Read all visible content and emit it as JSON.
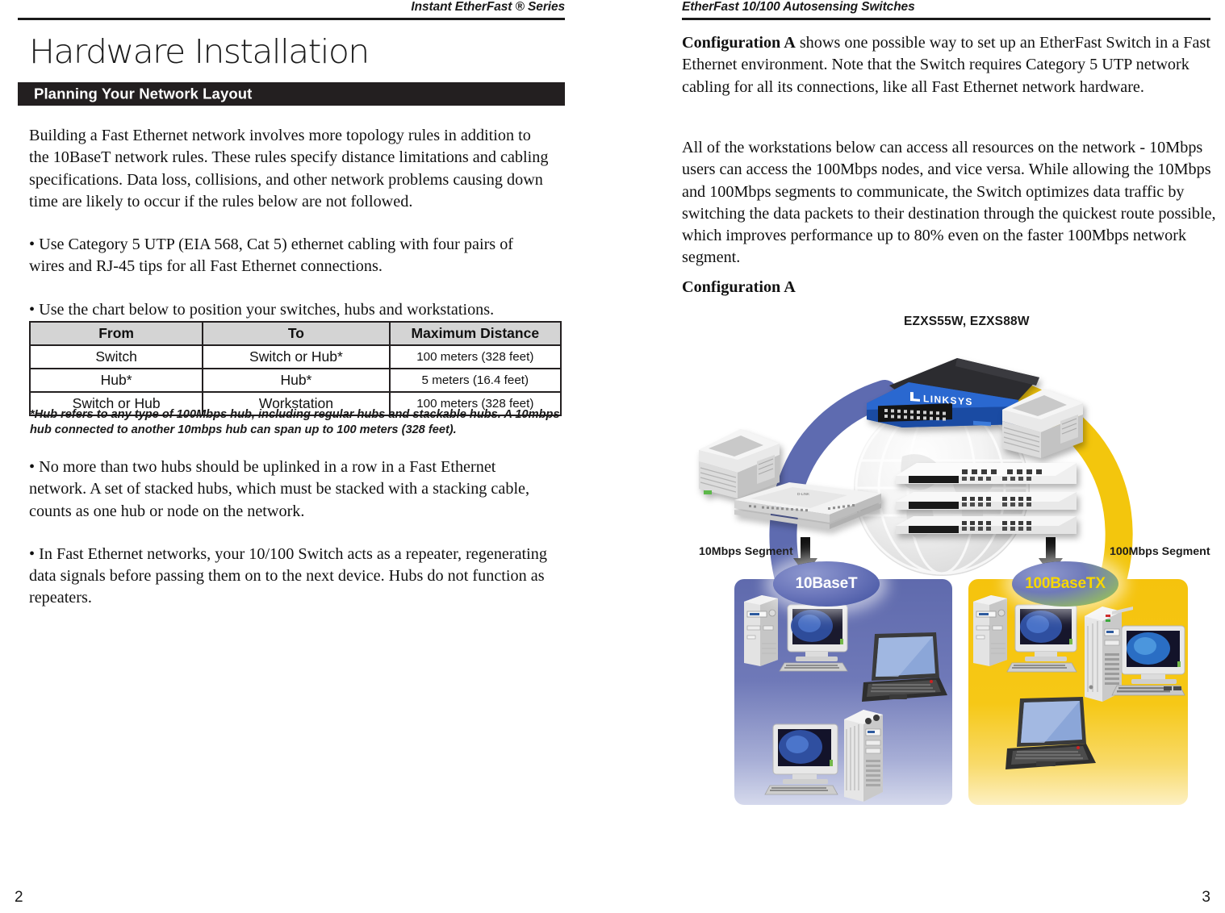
{
  "meta": {
    "left_page_number": "2",
    "right_page_number": "3"
  },
  "left_page": {
    "running_head": "Instant EtherFast ® Series",
    "title": "Hardware Installation",
    "section_bar_label": "Planning Your Network Layout",
    "intro_paragraph": "Building a Fast Ethernet network involves more topology rules in addition to the 10BaseT network rules.  These rules specify distance limitations and cabling specifications.  Data loss, collisions, and other network problems causing down time are likely to occur if the rules below are not followed.",
    "bullet_1": "• Use Category 5 UTP (EIA 568, Cat 5) ethernet cabling with four pairs of wires and RJ-45 tips for all Fast Ethernet connections.",
    "bullet_2": "• Use the chart below to position your switches, hubs and workstations.",
    "bullet_3": "• No more than two hubs should be uplinked in a row in a Fast Ethernet network.  A set of stacked hubs, which must be stacked with a stacking cable, counts as one hub or node on the network.",
    "bullet_4": "• In Fast Ethernet networks, your 10/100 Switch acts as a repeater, regenerating data signals before passing them on to the next device.  Hubs do not function as repeaters.",
    "table": {
      "headers": [
        "From",
        "To",
        "Maximum Distance"
      ],
      "rows": [
        [
          "Switch",
          "Switch or Hub*",
          "100 meters (328 feet)"
        ],
        [
          "Hub*",
          "Hub*",
          "5 meters (16.4 feet)"
        ],
        [
          "Switch or Hub",
          "Workstation",
          "100 meters (328 feet)"
        ]
      ],
      "footnote": "*Hub refers to any type of 100Mbps hub, including regular hubs and stackable hubs. A 10mbps hub connected to another 10mbps hub can span up to 100 meters (328 feet)."
    }
  },
  "right_page": {
    "running_head": "EtherFast 10/100 Autosensing Switches",
    "paragraph_1_lead": "Configuration A",
    "paragraph_1_rest": " shows one possible way to set up an EtherFast Switch in a Fast Ethernet environment. Note that the Switch requires Category 5 UTP network cabling for all its connections, like all Fast Ethernet network hardware.",
    "paragraph_2": "All of the workstations below can access all resources on the network - 10Mbps users can access the 100Mbps nodes, and vice versa. While allowing the 10Mbps and 100Mbps segments to communicate, the Switch optimizes data traffic by switching the data packets to their destination through the quickest route possible, which improves performance up to 80% even on the faster 100Mbps network segment.",
    "figure_caption": "Configuration A",
    "diagram": {
      "product_label": "EZXS55W, EZXS88W",
      "left_segment_label": "10Mbps Segment",
      "right_segment_label": "100Mbps Segment",
      "left_badge": "10BaseT",
      "right_badge": "100BaseTX",
      "switch_brand": "LINKSYS",
      "devices_left": [
        "printer",
        "desktop-hub",
        "tower-pc",
        "crt-monitor",
        "laptop",
        "tower-pc-tall"
      ],
      "devices_right": [
        "printer",
        "stacked-hub",
        "stacked-hub",
        "stacked-hub",
        "tower-pc",
        "crt-monitor",
        "server-tower",
        "crt-monitor",
        "laptop"
      ],
      "colors": {
        "left_panel": "#6f79b8",
        "right_panel": "#f5c30d",
        "blue_arc": "#5563ac",
        "yellow_arc": "#f2c300",
        "switch_body": "#1f56b5",
        "bar_black": "#231f20"
      }
    }
  }
}
